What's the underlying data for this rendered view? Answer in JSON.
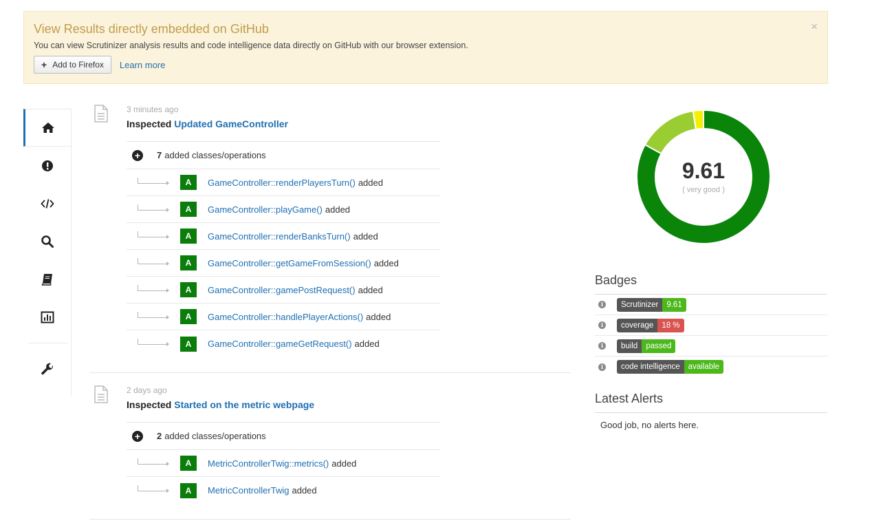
{
  "banner": {
    "title": "View Results directly embedded on GitHub",
    "text": "You can view Scrutinizer analysis results and code intelligence data directly on GitHub with our browser extension.",
    "add_button": "Add to Firefox",
    "learn_more": "Learn more",
    "close_glyph": "×"
  },
  "sidebar": {
    "items": [
      {
        "icon": "home-icon",
        "active": true
      },
      {
        "icon": "issues-icon",
        "active": false
      },
      {
        "icon": "code-icon",
        "active": false
      },
      {
        "icon": "search-icon",
        "active": false
      },
      {
        "icon": "book-icon",
        "active": false
      },
      {
        "icon": "chart-icon",
        "active": false
      },
      {
        "icon": "wrench-icon",
        "active": false
      }
    ]
  },
  "timeline": [
    {
      "time": "3 minutes ago",
      "prefix": "Inspected",
      "link": "Updated GameController",
      "summary_count": "7",
      "summary_text": "added classes/operations",
      "ops": [
        {
          "badge": "A",
          "name": "GameController::renderPlayersTurn()",
          "suffix": "added"
        },
        {
          "badge": "A",
          "name": "GameController::playGame()",
          "suffix": "added"
        },
        {
          "badge": "A",
          "name": "GameController::renderBanksTurn()",
          "suffix": "added"
        },
        {
          "badge": "A",
          "name": "GameController::getGameFromSession()",
          "suffix": "added"
        },
        {
          "badge": "A",
          "name": "GameController::gamePostRequest()",
          "suffix": "added"
        },
        {
          "badge": "A",
          "name": "GameController::handlePlayerActions()",
          "suffix": "added"
        },
        {
          "badge": "A",
          "name": "GameController::gameGetRequest()",
          "suffix": "added"
        }
      ]
    },
    {
      "time": "2 days ago",
      "prefix": "Inspected",
      "link": "Started on the metric webpage",
      "summary_count": "2",
      "summary_text": "added classes/operations",
      "ops": [
        {
          "badge": "A",
          "name": "MetricControllerTwig::metrics()",
          "suffix": "added"
        },
        {
          "badge": "A",
          "name": "MetricControllerTwig",
          "suffix": "added"
        }
      ]
    }
  ],
  "score": {
    "value": "9.61",
    "label": "( very good )",
    "segments": [
      {
        "share": 0.83,
        "color": "#0a850a"
      },
      {
        "share": 0.145,
        "color": "#9acd32"
      },
      {
        "share": 0.025,
        "color": "#f4f000"
      }
    ]
  },
  "badges": {
    "title": "Badges",
    "items": [
      {
        "key": "Scrutinizer",
        "value": "9.61",
        "color": "#4cb81c"
      },
      {
        "key": "coverage",
        "value": "18 %",
        "color": "#d9534f"
      },
      {
        "key": "build",
        "value": "passed",
        "color": "#4cb81c"
      },
      {
        "key": "code intelligence",
        "value": "available",
        "color": "#4cb81c"
      }
    ]
  },
  "alerts": {
    "title": "Latest Alerts",
    "text": "Good job, no alerts here."
  },
  "colors": {
    "link": "#1f6fb2",
    "banner_bg": "#fbf3dc",
    "banner_title": "#c29d4a",
    "added_badge": "#0a7d0a"
  }
}
